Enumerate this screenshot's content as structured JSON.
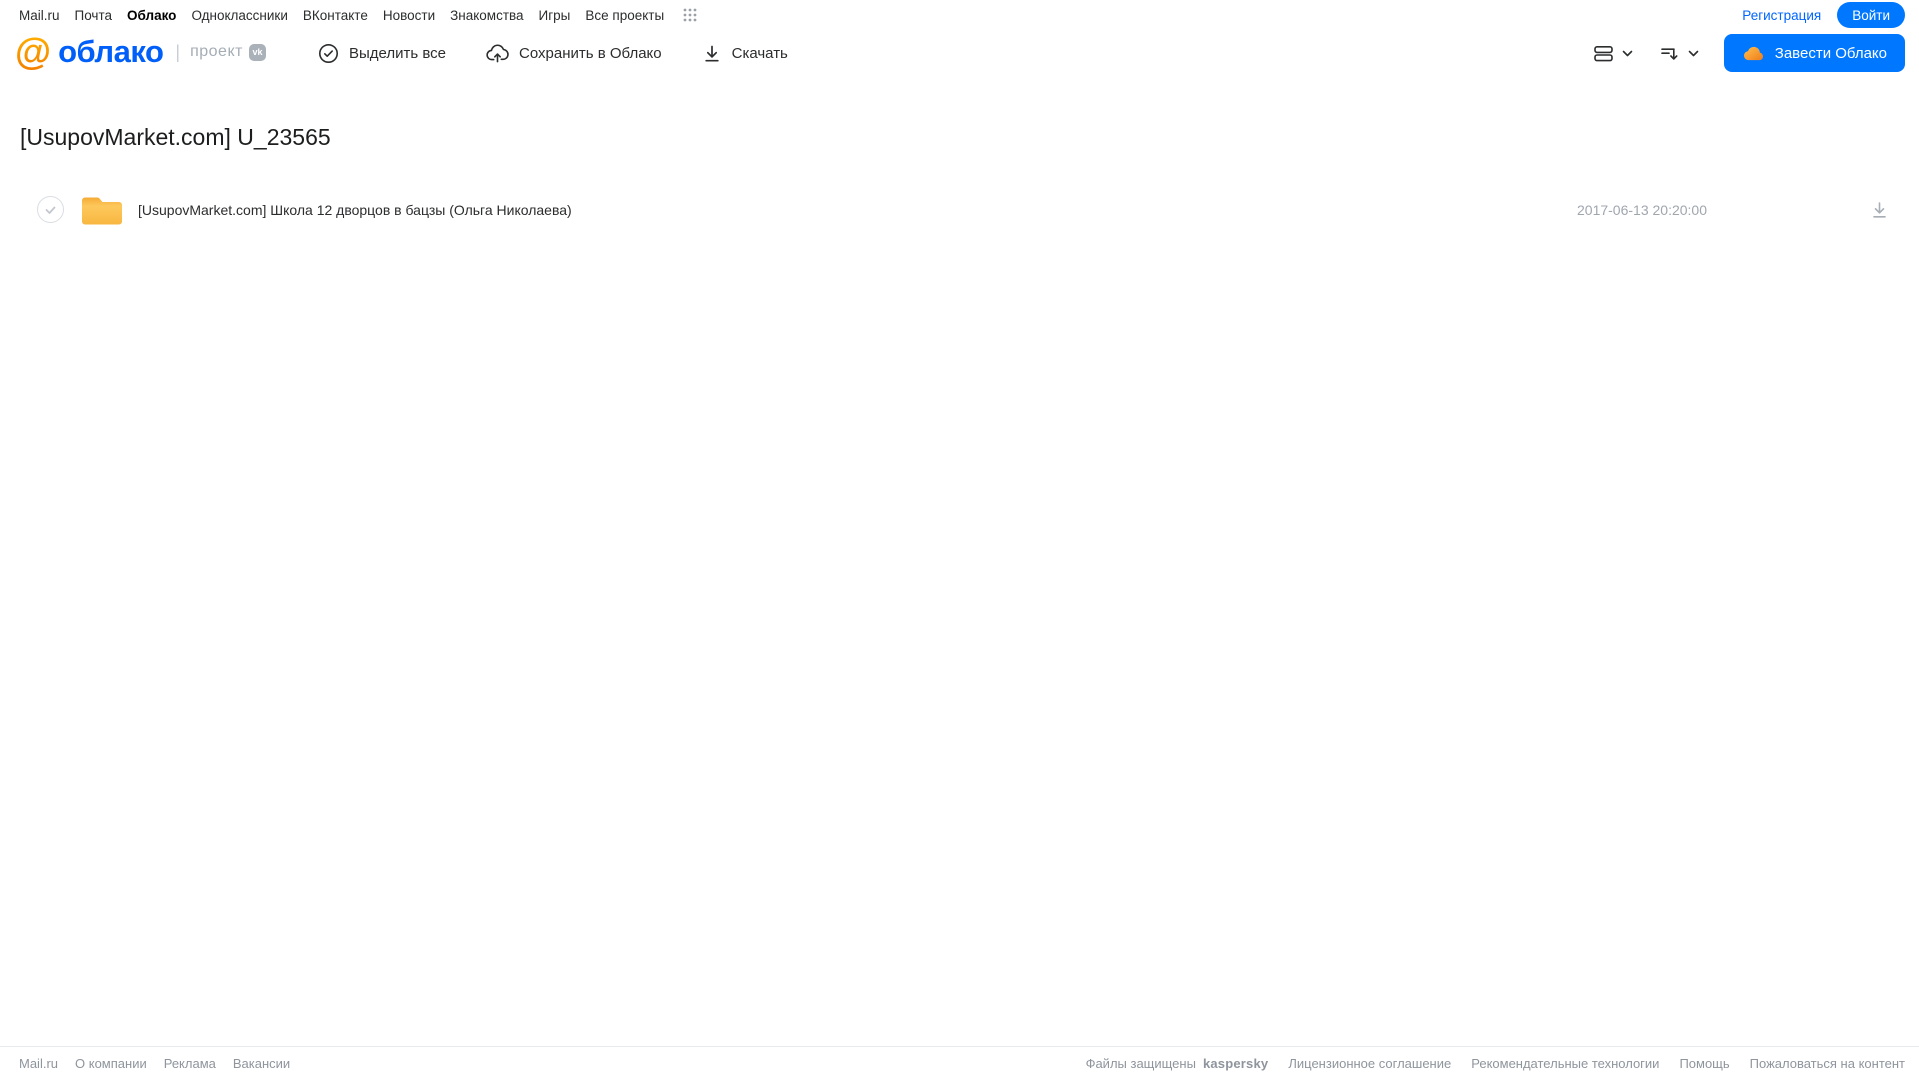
{
  "topnav": {
    "links": [
      "Mail.ru",
      "Почта",
      "Облако",
      "Одноклассники",
      "ВКонтакте",
      "Новости",
      "Знакомства",
      "Игры",
      "Все проекты"
    ],
    "active_link": "Облако",
    "registration": "Регистрация",
    "login": "Войти"
  },
  "header": {
    "logo": {
      "at": "@",
      "name": "облако",
      "project": "проект",
      "vk": "vk"
    },
    "toolbar": {
      "select_all": "Выделить все",
      "save_to_cloud": "Сохранить в Облако",
      "download": "Скачать"
    },
    "new_cloud_button": "Завести Облако"
  },
  "main": {
    "title": "[UsupovMarket.com] U_23565",
    "files": [
      {
        "type": "folder",
        "name": "[UsupovMarket.com] Школа 12 дворцов в бацзы (Ольга Николаева)",
        "date": "2017-06-13 20:20:00"
      }
    ]
  },
  "footer": {
    "left_links": [
      "Mail.ru",
      "О компании",
      "Реклама",
      "Вакансии"
    ],
    "protected_label": "Файлы защищены",
    "kaspersky": "kaspersky",
    "right_links": [
      "Лицензионное соглашение",
      "Рекомендательные технологии",
      "Помощь",
      "Пожаловаться на контент"
    ]
  },
  "icons": {
    "grid-icon": "3x3 dots app grid",
    "check-circle-icon": "circled checkmark",
    "cloud-upload-icon": "cloud with up arrow",
    "download-icon": "down arrow with underline",
    "view-mode-icon": "stacked rows",
    "sort-icon": "lines with down arrow",
    "chevron-down-icon": "˅",
    "cloud-icon": "orange cloud",
    "folder-icon": "yellow folder"
  },
  "colors": {
    "accent_blue": "#0077ff",
    "logo_blue": "#005ff9",
    "logo_orange": "#ff9900",
    "kaspersky_teal": "#009982",
    "folder_yellow": "#fcc14f",
    "muted_text": "#a0a6ae"
  }
}
